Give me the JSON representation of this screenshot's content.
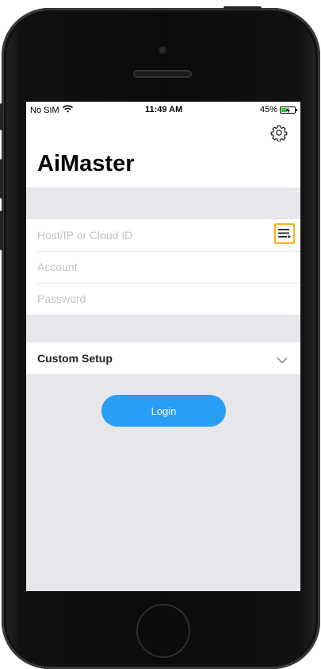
{
  "status_bar": {
    "carrier": "No SIM",
    "time": "11:49 AM",
    "battery_percent": "45%",
    "battery_level": 0.45,
    "wifi_icon": "wifi-icon",
    "battery_icon": "battery-charging-icon"
  },
  "header": {
    "title": "AiMaster",
    "settings_icon": "gear-icon"
  },
  "form": {
    "host_placeholder": "Host/IP or Cloud ID",
    "account_placeholder": "Account",
    "password_placeholder": "Password",
    "host_list_icon": "list-icon"
  },
  "custom_setup": {
    "label": "Custom Setup",
    "icon": "chevron-down-icon"
  },
  "login_button": {
    "label": "Login"
  },
  "colors": {
    "accent": "#1e9bf5",
    "highlight": "#f7b21b",
    "background": "#e6e6eb"
  }
}
